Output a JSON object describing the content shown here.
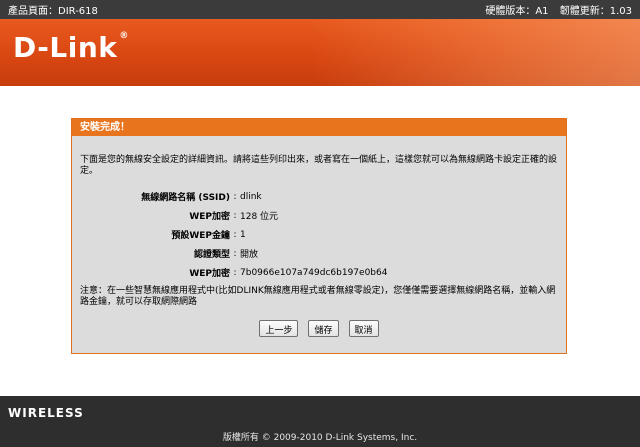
{
  "topbar": {
    "product_page": "產品頁面：DIR-618",
    "hardware_version": "硬體版本：A1",
    "firmware_version": "韌體更新：1.03"
  },
  "brand": {
    "logo": "D-Link",
    "registered": "®"
  },
  "panel": {
    "title": "安裝完成！",
    "intro": "下面是您的無線安全設定的詳細資訊。請將這些列印出來，或者寫在一個紙上，這樣您就可以為無線網路卡設定正確的設定。",
    "fields": [
      {
        "label": "無線網路名稱 (SSID)",
        "value": "dlink"
      },
      {
        "label": "WEP加密",
        "value": "128 位元"
      },
      {
        "label": "預設WEP金鑰",
        "value": "1"
      },
      {
        "label": "認證類型",
        "value": "開放"
      },
      {
        "label": "WEP加密",
        "value": "7b0966e107a749dc6b197e0b64"
      }
    ],
    "note": "注意：在一些智慧無線應用程式中(比如DLINK無線應用程式或者無線零設定)，您僅僅需要選擇無線網路名稱，並輸入網路金鑰，就可以存取網際網路",
    "buttons": {
      "prev": "上一步",
      "save": "儲存",
      "cancel": "取消"
    }
  },
  "footer": {
    "wireless": "WIRELESS",
    "copyright": "版權所有 © 2009-2010 D-Link Systems, Inc."
  }
}
